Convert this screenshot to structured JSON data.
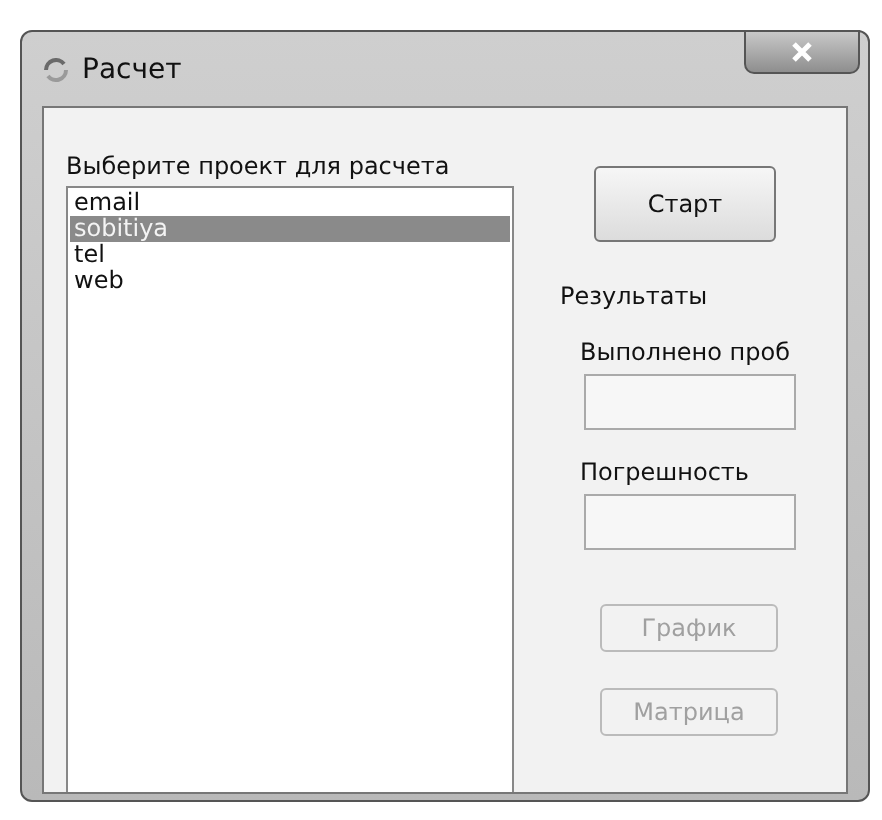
{
  "window": {
    "title": "Расчет"
  },
  "project_list": {
    "label": "Выберите проект для расчета",
    "items": [
      {
        "label": "email",
        "selected": false
      },
      {
        "label": "sobitiya",
        "selected": true
      },
      {
        "label": "tel",
        "selected": false
      },
      {
        "label": "web",
        "selected": false
      }
    ]
  },
  "start_button": {
    "label": "Старт",
    "disabled": false
  },
  "results": {
    "title": "Результаты",
    "fields": [
      {
        "label": "Выполнено проб"
      },
      {
        "label": "Погрешность"
      }
    ]
  },
  "buttons": [
    {
      "label": "График",
      "disabled": true
    },
    {
      "label": "Матрица",
      "disabled": true
    }
  ]
}
